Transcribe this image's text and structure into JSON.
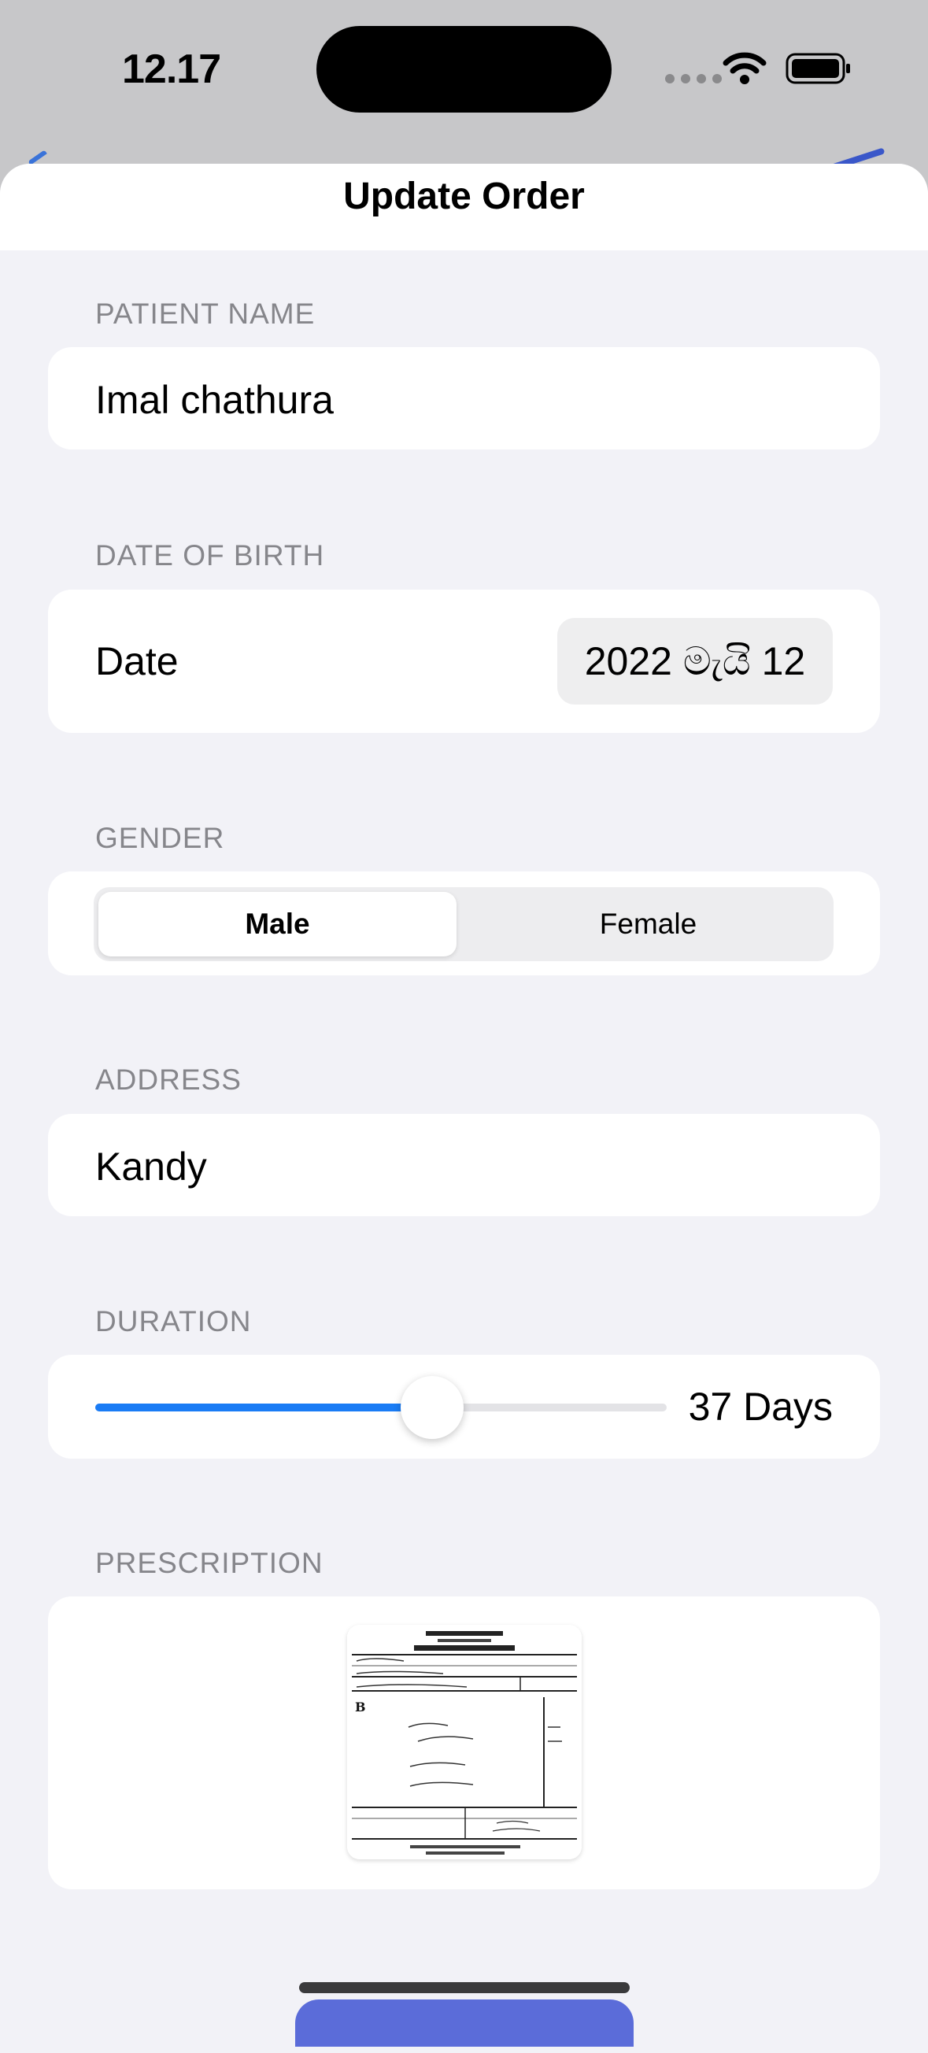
{
  "status_bar": {
    "time": "12.17"
  },
  "sheet": {
    "title": "Update Order"
  },
  "form": {
    "patient_name": {
      "label": "PATIENT NAME",
      "value": "Imal chathura"
    },
    "date_of_birth": {
      "label": "DATE OF BIRTH",
      "field_label": "Date",
      "value": "2022 මැයි 12"
    },
    "gender": {
      "label": "GENDER",
      "options": [
        "Male",
        "Female"
      ],
      "selected": "Male"
    },
    "address": {
      "label": "ADDRESS",
      "value": "Kandy"
    },
    "duration": {
      "label": "DURATION",
      "value_text": "37 Days",
      "slider_fraction": 0.59
    },
    "prescription": {
      "label": "PRESCRIPTION"
    }
  },
  "colors": {
    "accent": "#1a7cf5",
    "background": "#f2f2f7",
    "card": "#ffffff",
    "label": "#86868b"
  },
  "icons": [
    "wifi-icon",
    "battery-icon",
    "signal-dots-icon"
  ]
}
